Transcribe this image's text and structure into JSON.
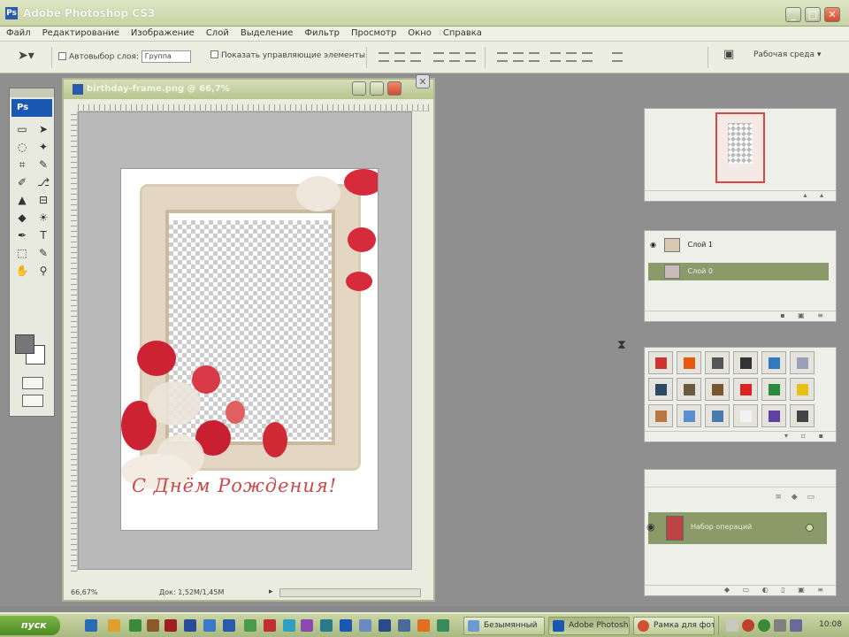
{
  "window": {
    "title": "Adobe Photoshop CS3",
    "minimize": "_",
    "maximize": "□",
    "close": "✕"
  },
  "menu": [
    "Файл",
    "Редактирование",
    "Изображение",
    "Слой",
    "Выделение",
    "Фильтр",
    "Просмотр",
    "Окно",
    "Справка"
  ],
  "options": {
    "auto_select_label": "Автовыбор слоя:",
    "auto_select_value": "Группа",
    "show_transform_label": "Показать управляющие элементы",
    "workspace_label": "Рабочая среда"
  },
  "tools": {
    "logo": "Ps",
    "items": [
      "▭",
      "➤",
      "◌",
      "✦",
      "⌗",
      "✎",
      "✐",
      "⎇",
      "▲",
      "⊟",
      "◆",
      "☀",
      "✒",
      "T",
      "⬚",
      "✎",
      "✋",
      "⚲"
    ]
  },
  "document": {
    "title": "birthday-frame.png @ 66,7%",
    "zoom": "66,67%",
    "info": "Док: 1,52M/1,45M",
    "greeting": "С Днём Рождения!"
  },
  "layers": {
    "items": [
      {
        "name": "Слой 1",
        "selected": false
      },
      {
        "name": "Слой 0",
        "selected": true
      }
    ]
  },
  "actions_panel": {
    "row_label": "Набор операций"
  },
  "styles": {
    "swatches": [
      "#c33",
      "#e55a10",
      "#555",
      "#333",
      "#2f7bbd",
      "#9aa0b8",
      "#2b4a66",
      "#6b5a40",
      "#7a5630",
      "#d22",
      "#2b8a3e",
      "#e6c018",
      "#b87840",
      "#5b8fd0",
      "#4a7ab0",
      "#f2f2f2",
      "#6040a0",
      "#444"
    ]
  },
  "taskbar": {
    "start": "пуск",
    "tasks": [
      {
        "label": "Безымянный",
        "active": false
      },
      {
        "label": "Adobe Photoshop",
        "active": true
      },
      {
        "label": "Рамка для фото",
        "active": false
      }
    ],
    "clock": "10:08"
  }
}
